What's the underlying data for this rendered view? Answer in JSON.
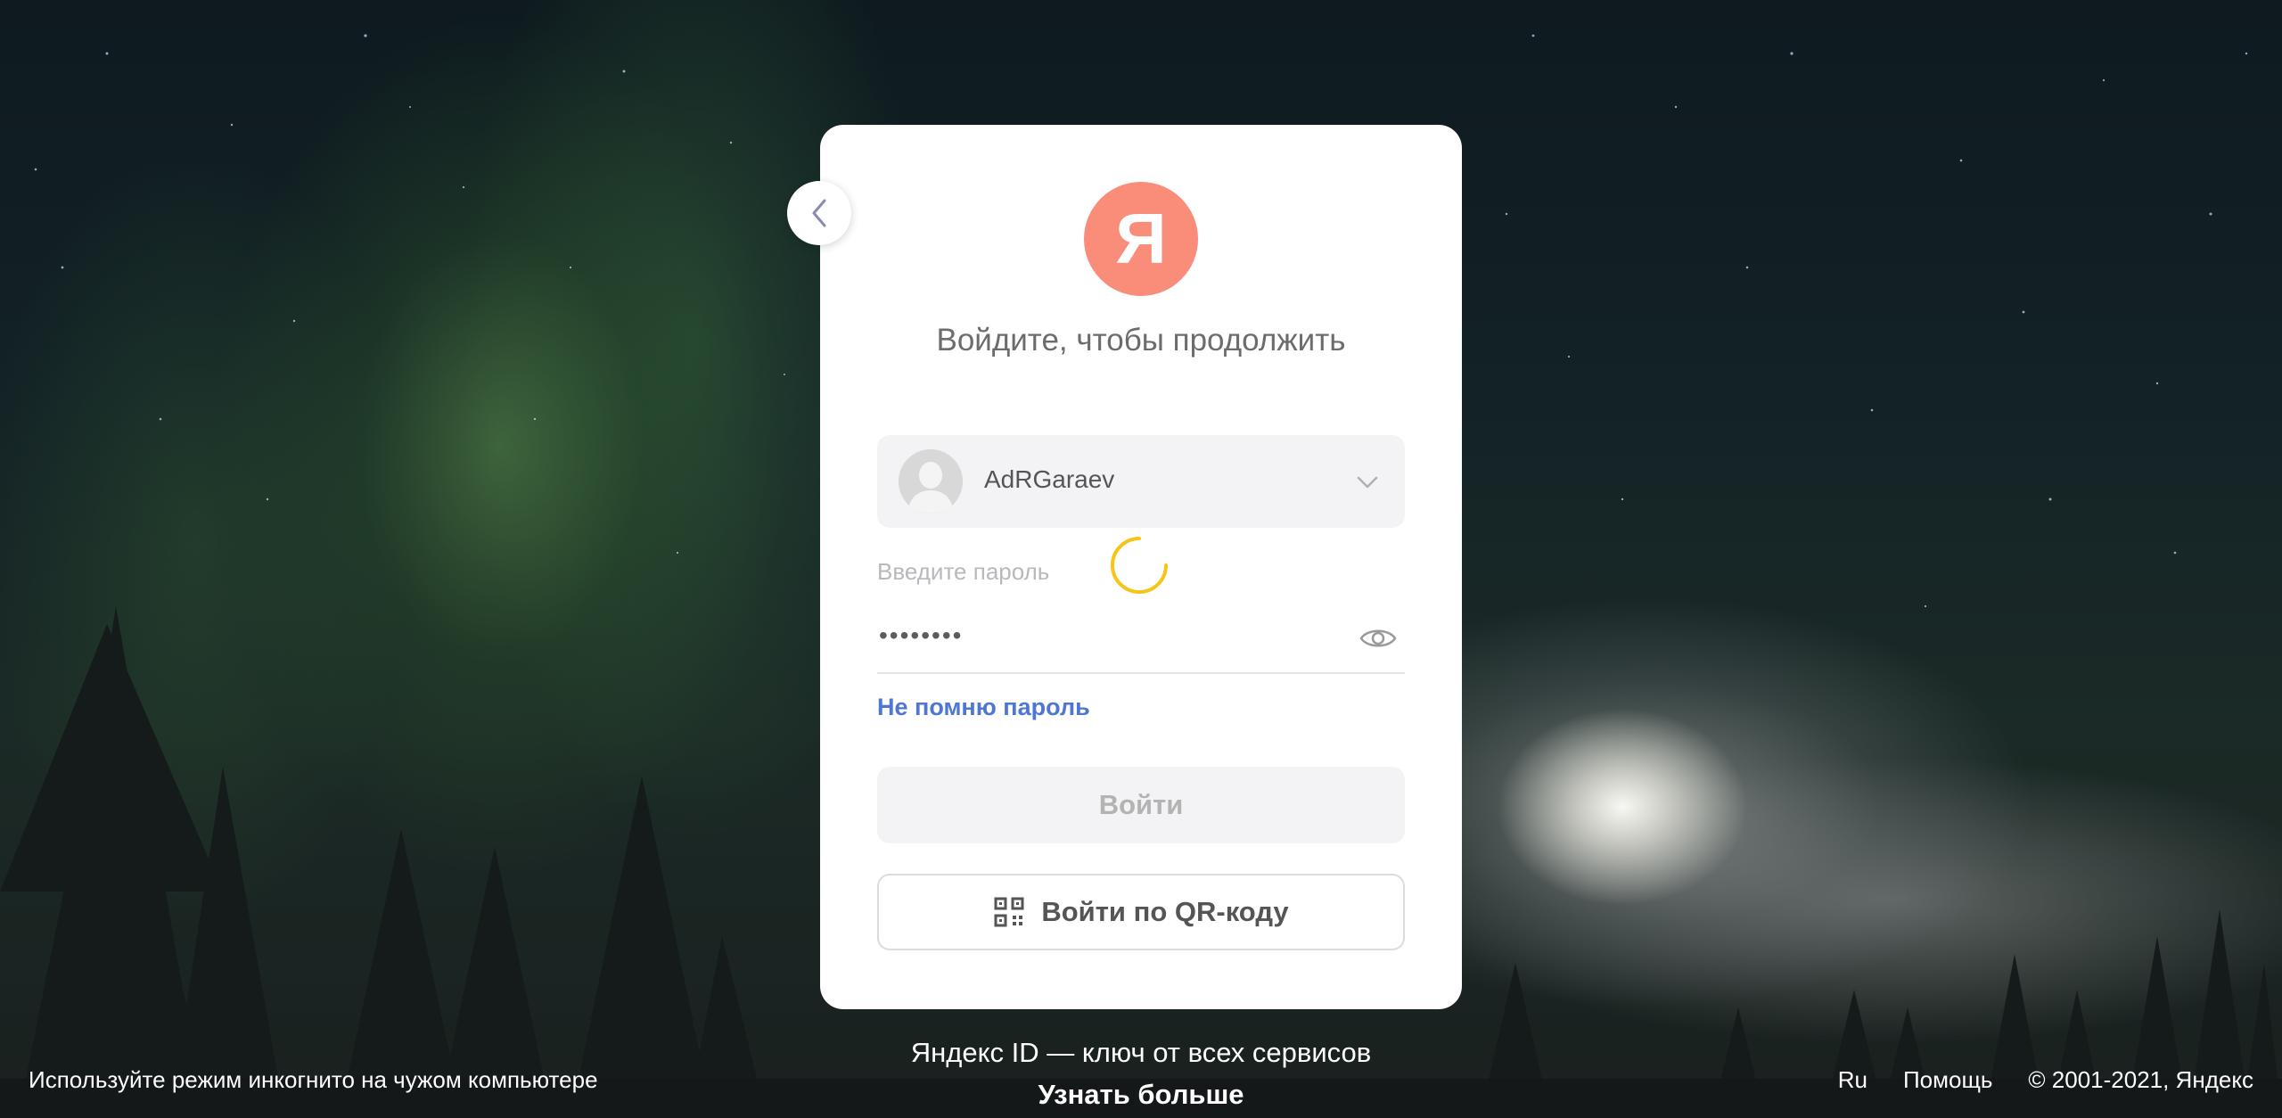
{
  "colors": {
    "logo": "#fa8c7a",
    "link": "#4f77d1",
    "spinner": "#f5c518",
    "card": "#ffffff"
  },
  "back_button": {
    "icon": "chevron-left-icon"
  },
  "logo": {
    "letter": "Я"
  },
  "title": "Войдите, чтобы продолжить",
  "account": {
    "name": "AdRGaraev",
    "icon": "chevron-down-icon"
  },
  "password": {
    "label": "Введите пароль",
    "value": "••••••••",
    "toggle_icon": "eye-icon"
  },
  "forgot_link": "Не помню пароль",
  "login_button": "Войти",
  "qr_button": {
    "label": "Войти по QR-коду",
    "icon": "qr-code-icon"
  },
  "promo": {
    "tagline": "Яндекс ID — ключ от всех сервисов",
    "learn_more": "Узнать больше"
  },
  "footer": {
    "incognito_hint": "Используйте режим инкогнито на чужом компьютере",
    "language": "Ru",
    "help": "Помощь",
    "copyright": "© 2001-2021, Яндекс"
  }
}
